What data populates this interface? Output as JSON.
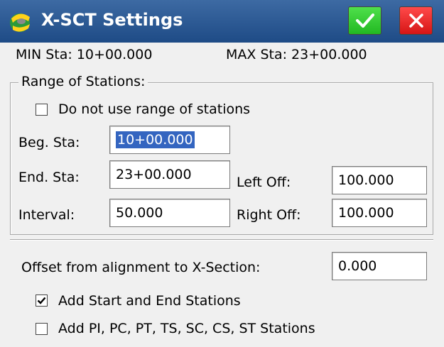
{
  "window": {
    "title": "X-SCT Settings",
    "ok_icon": "check-icon",
    "close_icon": "close-icon"
  },
  "info": {
    "min_sta": "MIN Sta: 10+00.000",
    "max_sta": "MAX Sta: 23+00.000"
  },
  "range_group": {
    "legend": "Range of Stations:",
    "no_range_label": "Do not use range of stations",
    "no_range_checked": false,
    "beg_label": "Beg. Sta:",
    "beg_value": "10+00.000",
    "end_label": "End. Sta:",
    "end_value": "23+00.000",
    "interval_label": "Interval:",
    "interval_value": "50.000",
    "left_off_label": "Left Off:",
    "left_off_value": "100.000",
    "right_off_label": "Right Off:",
    "right_off_value": "100.000"
  },
  "offset": {
    "label": "Offset from alignment to X-Section:",
    "value": "0.000"
  },
  "options": {
    "add_start_end_label": "Add Start and End Stations",
    "add_start_end_checked": true,
    "add_pi_label": "Add PI, PC, PT, TS, SC, CS, ST Stations",
    "add_pi_checked": false
  },
  "colors": {
    "titlebar": "#2a5a96",
    "ok": "#2fc92c",
    "close": "#e82222",
    "selection": "#3465c0"
  }
}
